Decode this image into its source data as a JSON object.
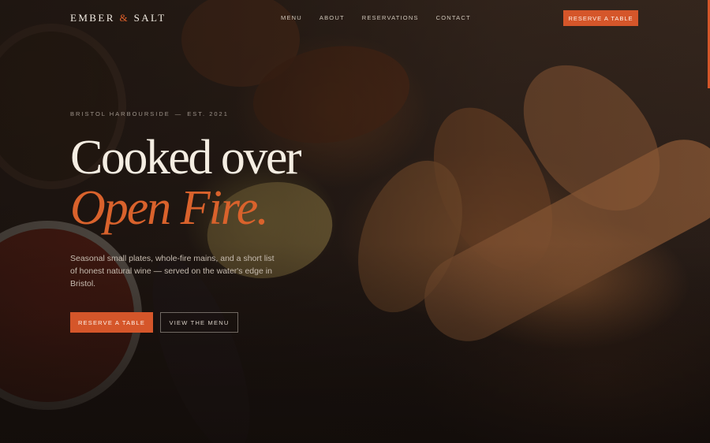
{
  "brand": {
    "name_part1": "EMBER",
    "ampersand": "&",
    "name_part2": "SALT"
  },
  "nav": {
    "items": [
      "MENU",
      "ABOUT",
      "RESERVATIONS",
      "CONTACT"
    ]
  },
  "header_cta": "RESERVE A TABLE",
  "hero": {
    "eyebrow_location": "BRISTOL HARBOURSIDE",
    "eyebrow_separator": "—",
    "eyebrow_established": "EST. 2021",
    "headline_line1": "Cooked over",
    "headline_line2": "Open Fire.",
    "lede": "Seasonal small plates, whole-fire mains, and a short list of honest natural wine — served on the water's edge in Bristol.",
    "primary_cta": "RESERVE A TABLE",
    "secondary_cta": "VIEW THE MENU"
  },
  "colors": {
    "accent": "#d5562a",
    "headline": "#f4ede2",
    "background": "#1b1411"
  }
}
